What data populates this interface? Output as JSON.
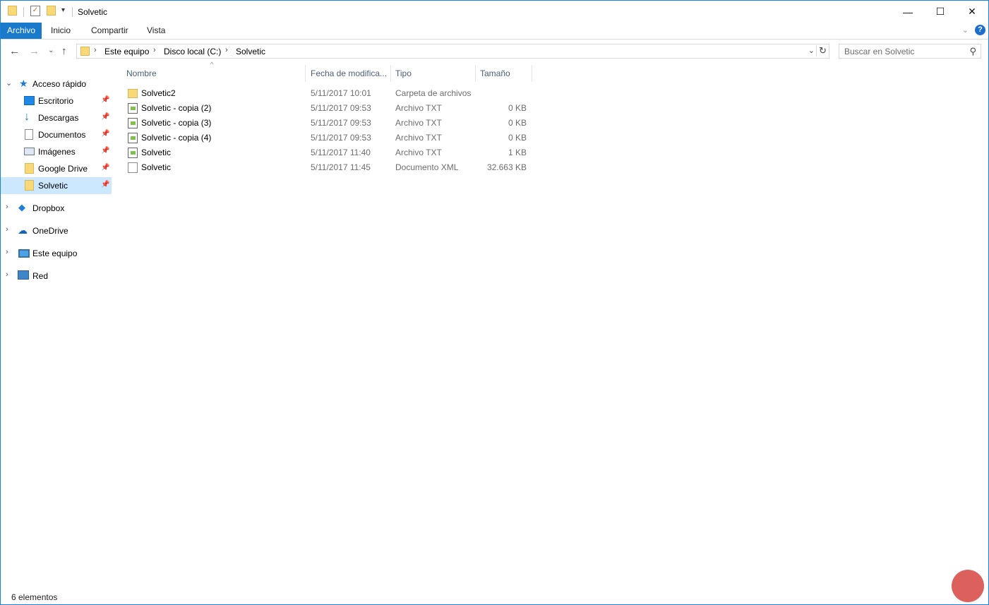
{
  "window": {
    "title": "Solvetic",
    "controls": {
      "minimize": "—",
      "maximize": "☐",
      "close": "✕"
    }
  },
  "ribbon": {
    "tabs": [
      "Archivo",
      "Inicio",
      "Compartir",
      "Vista"
    ],
    "help": "?"
  },
  "navigation": {
    "breadcrumb": [
      "Este equipo",
      "Disco local (C:)",
      "Solvetic"
    ],
    "search_placeholder": "Buscar en Solvetic"
  },
  "sidebar": {
    "quick_access": "Acceso rápido",
    "pinned": [
      {
        "label": "Escritorio",
        "icon": "desktop-icon"
      },
      {
        "label": "Descargas",
        "icon": "download-icon"
      },
      {
        "label": "Documentos",
        "icon": "documents-icon"
      },
      {
        "label": "Imágenes",
        "icon": "pictures-icon"
      },
      {
        "label": "Google Drive",
        "icon": "folder-icon"
      },
      {
        "label": "Solvetic",
        "icon": "folder-icon",
        "selected": true
      }
    ],
    "roots": [
      {
        "label": "Dropbox",
        "icon": "dropbox-icon"
      },
      {
        "label": "OneDrive",
        "icon": "onedrive-icon"
      },
      {
        "label": "Este equipo",
        "icon": "computer-icon"
      },
      {
        "label": "Red",
        "icon": "network-icon"
      }
    ]
  },
  "file_list": {
    "columns": [
      "Nombre",
      "Fecha de modifica...",
      "Tipo",
      "Tamaño"
    ],
    "rows": [
      {
        "name": "Solvetic2",
        "date": "5/11/2017 10:01",
        "type": "Carpeta de archivos",
        "size": "",
        "icon": "folder-icon"
      },
      {
        "name": "Solvetic - copia (2)",
        "date": "5/11/2017 09:53",
        "type": "Archivo TXT",
        "size": "0 KB",
        "icon": "text-file-icon"
      },
      {
        "name": "Solvetic - copia (3)",
        "date": "5/11/2017 09:53",
        "type": "Archivo TXT",
        "size": "0 KB",
        "icon": "text-file-icon"
      },
      {
        "name": "Solvetic - copia (4)",
        "date": "5/11/2017 09:53",
        "type": "Archivo TXT",
        "size": "0 KB",
        "icon": "text-file-icon"
      },
      {
        "name": "Solvetic",
        "date": "5/11/2017 11:40",
        "type": "Archivo TXT",
        "size": "1 KB",
        "icon": "text-file-icon"
      },
      {
        "name": "Solvetic",
        "date": "5/11/2017 11:45",
        "type": "Documento XML",
        "size": "32.663 KB",
        "icon": "xml-file-icon"
      }
    ]
  },
  "status_bar": {
    "item_count": "6 elementos"
  },
  "colors": {
    "accent": "#1979ca",
    "selection": "#cce8ff",
    "border": "#1883d7"
  }
}
